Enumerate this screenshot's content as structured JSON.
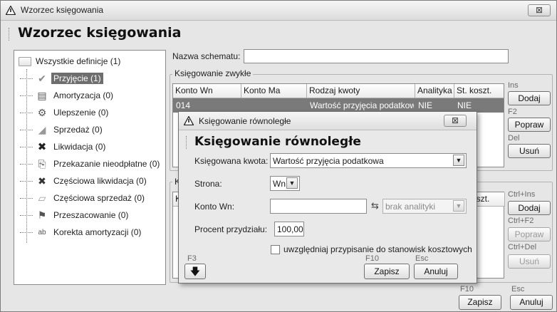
{
  "window": {
    "title": "Wzorzec księgowania",
    "heading": "Wzorzec księgowania",
    "close_glyph": "⊠"
  },
  "tree": {
    "root": "Wszystkie definicje (1)",
    "items": [
      {
        "label": "Przyjęcie (1)",
        "icon": "check-icon",
        "glyph": "✔",
        "selected": true
      },
      {
        "label": "Amortyzacja (0)",
        "icon": "document-icon",
        "glyph": "▤"
      },
      {
        "label": "Ulepszenie (0)",
        "icon": "gears-icon",
        "glyph": "⚙"
      },
      {
        "label": "Sprzedaż (0)",
        "icon": "sale-icon",
        "glyph": "◢"
      },
      {
        "label": "Likwidacja (0)",
        "icon": "cross-icon",
        "glyph": "✖"
      },
      {
        "label": "Przekazanie nieodpłatne (0)",
        "icon": "transfer-icon",
        "glyph": "⎘"
      },
      {
        "label": "Częściowa likwidacja (0)",
        "icon": "partial-cross-icon",
        "glyph": "✖"
      },
      {
        "label": "Częściowa sprzedaż (0)",
        "icon": "partial-sale-icon",
        "glyph": "▱"
      },
      {
        "label": "Przeszacowanie (0)",
        "icon": "revaluation-icon",
        "glyph": "⚑"
      },
      {
        "label": "Korekta amortyzacji (0)",
        "icon": "text-correction-icon",
        "glyph": "ab"
      }
    ]
  },
  "form": {
    "schema_label": "Nazwa schematu:",
    "schema_value": "",
    "group1_title": "Księgowanie zwykłe",
    "group2_title_partial": "K",
    "columns": [
      "Konto Wn",
      "Konto Ma",
      "Rodzaj kwoty",
      "Analityka",
      "St. koszt."
    ],
    "row": [
      "014",
      "",
      "Wartość przyjęcia podatkowa",
      "NIE",
      "NIE"
    ],
    "g2_col_partial": "K",
    "g2_col_koszt": "koszt."
  },
  "side_buttons_top": [
    {
      "key": "Ins",
      "label": "Dodaj",
      "disabled": false
    },
    {
      "key": "F2",
      "label": "Popraw",
      "disabled": false
    },
    {
      "key": "Del",
      "label": "Usuń",
      "disabled": false
    }
  ],
  "side_buttons_bottom": [
    {
      "key": "Ctrl+Ins",
      "label": "Dodaj",
      "disabled": false
    },
    {
      "key": "Ctrl+F2",
      "label": "Popraw",
      "disabled": true
    },
    {
      "key": "Ctrl+Del",
      "label": "Usuń",
      "disabled": true
    }
  ],
  "footer": {
    "save_key": "F10",
    "save_label": "Zapisz",
    "cancel_key": "Esc",
    "cancel_label": "Anuluj"
  },
  "dialog": {
    "title": "Księgowanie równoległe",
    "heading": "Księgowanie równoległe",
    "amount_label": "Księgowana kwota:",
    "amount_value": "Wartość przyjęcia podatkowa",
    "side_label": "Strona:",
    "side_value": "Wn",
    "account_label": "Konto Wn:",
    "account_value": "",
    "analytics_value": "brak analityki",
    "percent_label": "Procent przydziału:",
    "percent_value": "100,00",
    "checkbox_label": "uwzględniaj przypisanie do stanowisk kosztowych",
    "checked": false,
    "f3_key": "F3",
    "save_key": "F10",
    "save_label": "Zapisz",
    "cancel_key": "Esc",
    "cancel_label": "Anuluj",
    "close_glyph": "⊠"
  }
}
